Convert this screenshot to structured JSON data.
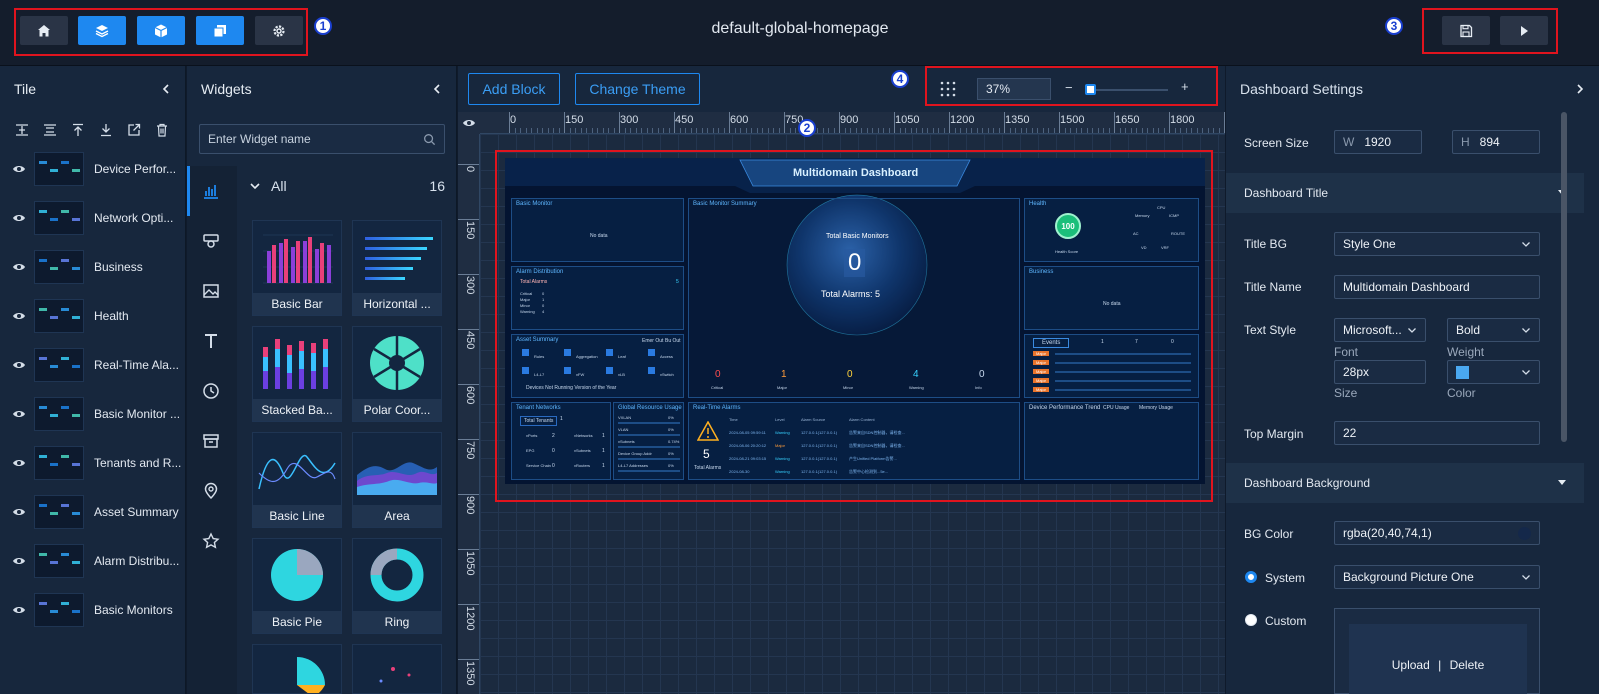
{
  "header": {
    "title": "default-global-homepage",
    "toolbar_buttons": [
      {
        "name": "home",
        "icon": "home-icon"
      },
      {
        "name": "layers",
        "icon": "layers-icon"
      },
      {
        "name": "cube",
        "icon": "cube-icon"
      },
      {
        "name": "copy",
        "icon": "copy-icon"
      },
      {
        "name": "settings",
        "icon": "gear-icon"
      }
    ],
    "save_icon": "save-icon",
    "play_icon": "play-icon",
    "badges": [
      "1",
      "2",
      "3",
      "4"
    ]
  },
  "tile_panel": {
    "title": "Tile",
    "items": [
      {
        "label": "Device Perfor..."
      },
      {
        "label": "Network Opti..."
      },
      {
        "label": "Business"
      },
      {
        "label": "Health"
      },
      {
        "label": "Real-Time Ala..."
      },
      {
        "label": "Basic Monitor ..."
      },
      {
        "label": "Tenants and R..."
      },
      {
        "label": "Asset Summary"
      },
      {
        "label": "Alarm Distribu..."
      },
      {
        "label": "Basic Monitors"
      }
    ]
  },
  "widgets_panel": {
    "title": "Widgets",
    "search_placeholder": "Enter Widget name",
    "group_label": "All",
    "group_count": "16",
    "cards": [
      {
        "label": "Basic Bar"
      },
      {
        "label": "Horizontal ..."
      },
      {
        "label": "Stacked Ba..."
      },
      {
        "label": "Polar Coor..."
      },
      {
        "label": "Basic Line"
      },
      {
        "label": "Area"
      },
      {
        "label": "Basic Pie"
      },
      {
        "label": "Ring"
      }
    ]
  },
  "canvas": {
    "add_block": "Add Block",
    "change_theme": "Change Theme",
    "zoom": "37%",
    "zoom_minus": "−",
    "zoom_plus": "+",
    "ruler_h": [
      "0",
      "150",
      "300",
      "450",
      "600",
      "750",
      "900",
      "1050",
      "1200",
      "1350",
      "1500",
      "1650",
      "1800",
      "19"
    ],
    "ruler_v": [
      "0",
      "150",
      "300",
      "450",
      "600",
      "750",
      "900",
      "1050",
      "1200",
      "1350"
    ]
  },
  "dashboard": {
    "title": "Multidomain Dashboard",
    "basic_monitor": "Basic Monitor",
    "no_data": "No data",
    "basic_monitor_summary": "Basic Monitor Summary",
    "total_basic_monitors": "Total Basic Monitors",
    "total_value": "0",
    "total_alarms": "Total Alarms:  5",
    "health": "Health",
    "health_value": "100",
    "health_score": "Health Score",
    "radar": [
      "CPU",
      "Memory",
      "ICMP",
      "AC",
      "ROUTE",
      "VD",
      "VRF"
    ],
    "alarm_distribution": "Alarm Distribution",
    "alarm_total": "Total Alarms",
    "alarm_total_value": "5",
    "alarm_rows": [
      {
        "label": "Critical",
        "value": "0"
      },
      {
        "label": "Major",
        "value": "1"
      },
      {
        "label": "Minor",
        "value": "0"
      },
      {
        "label": "Warning",
        "value": "4"
      },
      {
        "label": "Info",
        "value": "0"
      }
    ],
    "business": "Business",
    "asset_summary": "Asset Summary",
    "asset_legend": [
      "Emer Out",
      "Bu Out"
    ],
    "asset_items": [
      "Rules",
      "Aggregation",
      "Leaf",
      "Access",
      "L4-L7",
      "vFW",
      "vLB",
      "vSwitch"
    ],
    "asset_note": "Devices Not Running Version of the Year",
    "severity": [
      {
        "label": "Critical",
        "value": "0",
        "color": "#ff4d4f"
      },
      {
        "label": "Major",
        "value": "1",
        "color": "#ff9c3b"
      },
      {
        "label": "Minor",
        "value": "0",
        "color": "#ffd23b"
      },
      {
        "label": "Warning",
        "value": "4",
        "color": "#36d1ff"
      },
      {
        "label": "Info",
        "value": "0",
        "color": "#c8d9ee"
      }
    ],
    "events_tab": "Events",
    "events_counts": [
      "1",
      "7",
      "0"
    ],
    "event_tag": "Major",
    "tenant_networks": "Tenant Networks",
    "total_tenants": "Total Tenants",
    "tenant_count": "1",
    "tenant_items": [
      {
        "label": "vPorts",
        "value": "2"
      },
      {
        "label": "vNetworks",
        "value": "1"
      },
      {
        "label": "EPG",
        "value": "0"
      },
      {
        "label": "vSubnets",
        "value": "1"
      },
      {
        "label": "Service Chain",
        "value": "0"
      },
      {
        "label": "vRouters",
        "value": "1"
      }
    ],
    "global_resource_usage": "Global Resource Usage",
    "resource_items": [
      {
        "label": "VXLAN",
        "value": "0%"
      },
      {
        "label": "VLAN",
        "value": "0%"
      },
      {
        "label": "vSubnets",
        "value": "0.74%"
      },
      {
        "label": "Device Group Addr",
        "value": "0%"
      },
      {
        "label": "L4-L7 Addresses",
        "value": "0%"
      }
    ],
    "realtime_alarms": "Real-Time Alarms",
    "rt_total": "5",
    "rt_total_label": "Total Alarms",
    "rt_headers": [
      "Time",
      "Level",
      "Alarm Source",
      "Alarm Content"
    ],
    "rt_rows": [
      {
        "time": "2024-08-05 09:59:11",
        "level": "Warning",
        "source": "127.0.0.1(127.0.0.1)",
        "content": "告警来自SDN控制器，请检查..."
      },
      {
        "time": "2024-08-06 20:20:12",
        "level": "Major",
        "source": "127.0.0.1(127.0.0.1)",
        "content": "告警来自SDN控制器，请检查..."
      },
      {
        "time": "2024-08-21 09:03:15",
        "level": "Warning",
        "source": "127.0.0.1(127.0.0.1)",
        "content": "产生Unified Platform告警..."
      },
      {
        "time": "2024-08-30",
        "level": "Warning",
        "source": "127.0.0.1(127.0.0.1)",
        "content": "告警中心检测到...5e..."
      }
    ],
    "device_perf": "Device Performance Trend",
    "cpu_usage": "CPU Usage",
    "memory_usage": "Memory Usage"
  },
  "settings": {
    "title": "Dashboard Settings",
    "screen_size": "Screen Size",
    "w_prefix": "W",
    "width": "1920",
    "h_prefix": "H",
    "height": "894",
    "dashboard_title_section": "Dashboard Title",
    "title_bg_label": "Title BG",
    "title_bg_value": "Style One",
    "title_name_label": "Title Name",
    "title_name_value": "Multidomain Dashboard",
    "text_style_label": "Text Style",
    "font_value": "Microsoft...",
    "weight_value": "Bold",
    "font_sub": "Font",
    "weight_sub": "Weight",
    "size_value": "28px",
    "size_sub": "Size",
    "color_sub": "Color",
    "color_swatch": "#4aa8f0",
    "top_margin_label": "Top Margin",
    "top_margin_value": "22",
    "background_section": "Dashboard Background",
    "bg_color_label": "BG Color",
    "bg_color_value": "rgba(20,40,74,1)",
    "system_label": "System",
    "system_value": "Background Picture One",
    "custom_label": "Custom",
    "upload": "Upload",
    "delete": "Delete"
  },
  "colors": {
    "accent": "#1e88f0",
    "highlight": "#e0141e"
  }
}
